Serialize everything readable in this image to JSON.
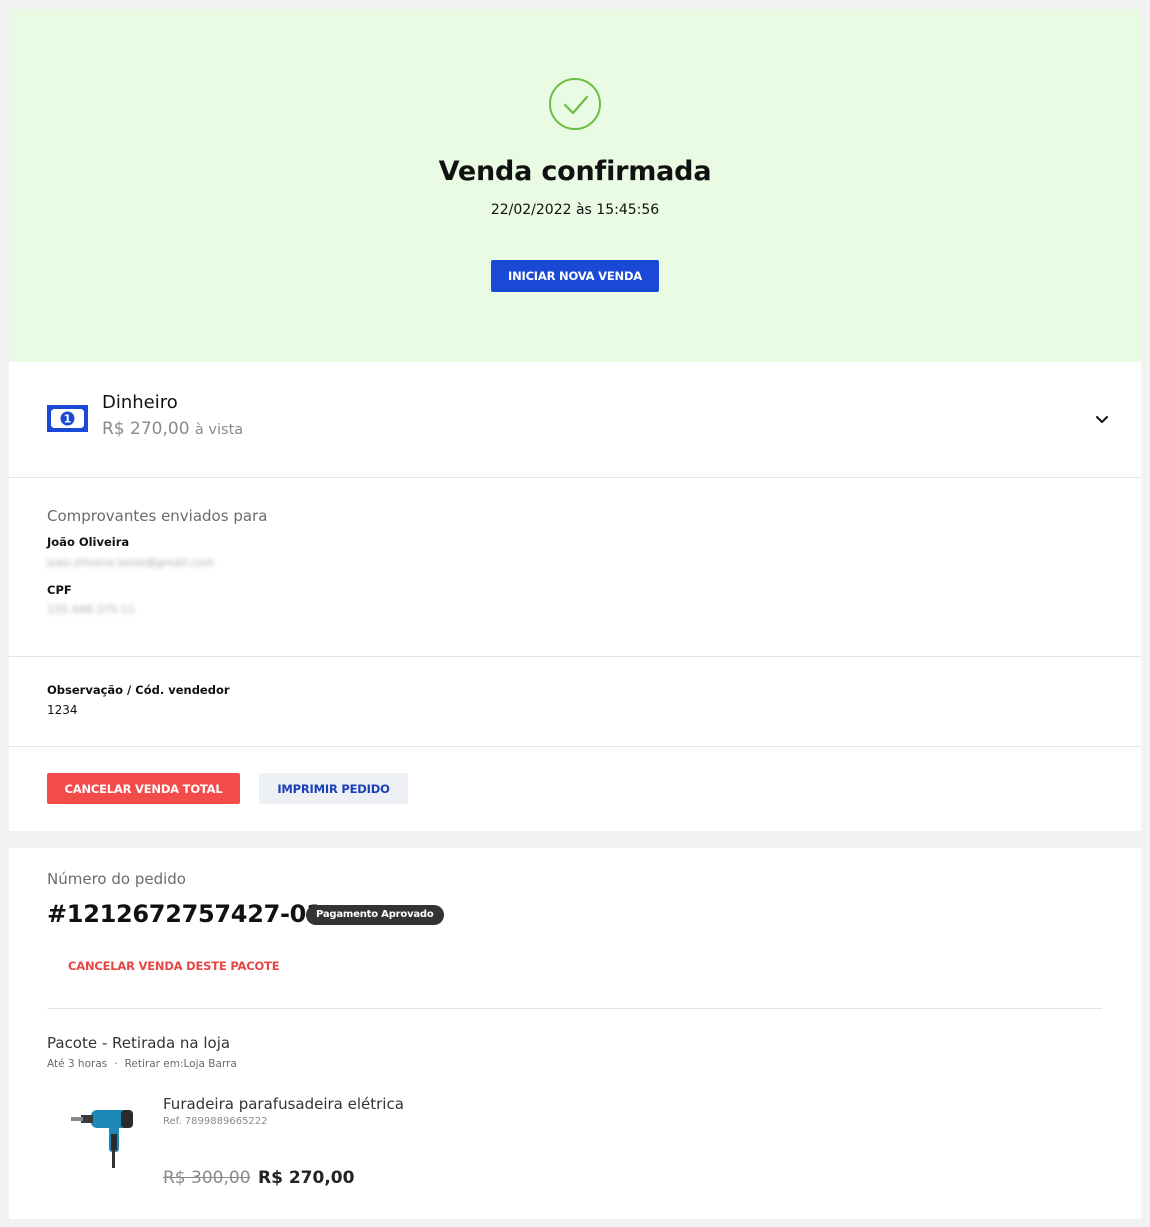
{
  "hero": {
    "title": "Venda confirmada",
    "datetime": "22/02/2022 às 15:45:56",
    "new_sale_button": "INICIAR NOVA VENDA",
    "accent_color": "#6cbc46",
    "icon": "check-circle-icon"
  },
  "payment": {
    "method": "Dinheiro",
    "amount": "R$ 270,00",
    "condition": "à vista",
    "icon": "cash-bill-icon",
    "expand_icon": "chevron-down-icon"
  },
  "receipts": {
    "heading": "Comprovantes enviados para",
    "customer_name": "João Oliveira",
    "customer_email": "joao.oliveira.teste@gmail.com",
    "cpf_label": "CPF",
    "cpf_value": "155.448.375-11"
  },
  "notes": {
    "label": "Observação / Cód. vendedor",
    "value": "1234"
  },
  "actions": {
    "cancel_total": "CANCELAR VENDA TOTAL",
    "print_order": "IMPRIMIR PEDIDO"
  },
  "order": {
    "label": "Número do pedido",
    "number": "#1212672757427-01",
    "status": "Pagamento Aprovado",
    "cancel_package": "CANCELAR VENDA DESTE PACOTE",
    "package": {
      "title": "Pacote - Retirada na loja",
      "eta": "Até 3 horas",
      "pickup": "Retirar em:Loja Barra"
    },
    "product": {
      "name": "Furadeira parafusadeira elétrica",
      "ref": "Ref. 7899889665222",
      "price_old": "R$ 300,00",
      "price_new": "R$ 270,00",
      "image": "drill-image"
    }
  },
  "colors": {
    "primary": "#1a49d6",
    "danger": "#f34a4a",
    "hero_bg": "#e9fbe3"
  }
}
